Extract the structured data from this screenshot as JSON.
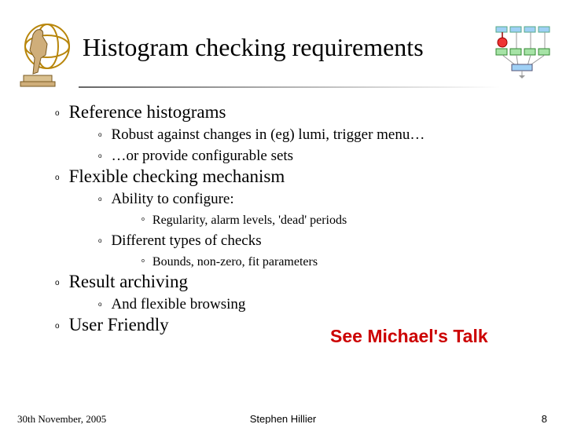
{
  "title": "Histogram checking requirements",
  "logo_alt": "atlas-figure",
  "bullets": {
    "b1": "Reference histograms",
    "b1a": "Robust against changes in (eg) lumi, trigger menu…",
    "b1b": "…or provide configurable sets",
    "b2": "Flexible checking mechanism",
    "b2a": "Ability to configure:",
    "b2a1": "Regularity, alarm levels, 'dead' periods",
    "b2b": "Different types of checks",
    "b2b1": "Bounds, non-zero, fit parameters",
    "b3": "Result archiving",
    "b3a": "And flexible browsing",
    "b4": "User Friendly"
  },
  "callout": "See Michael's Talk",
  "footer": {
    "date": "30th November, 2005",
    "author": "Stephen Hillier",
    "page": "8"
  }
}
